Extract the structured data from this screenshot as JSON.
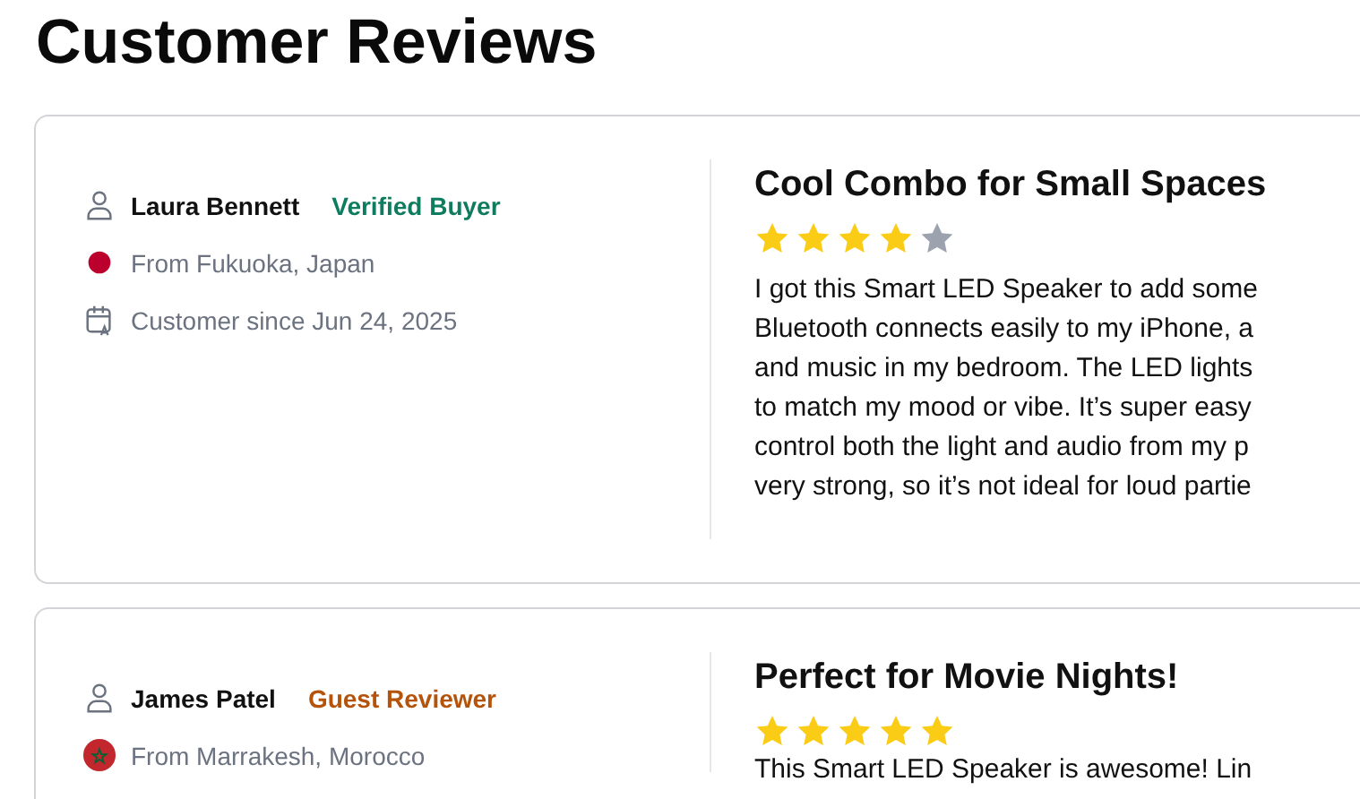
{
  "page_title": "Customer Reviews",
  "reviews": [
    {
      "reviewer": "Laura Bennett",
      "badge": {
        "text": "Verified Buyer",
        "kind": "verified"
      },
      "location": {
        "text": "From Fukuoka, Japan",
        "flag": {
          "kind": "dot",
          "color": "#bc002d"
        }
      },
      "customer_since": "Customer since Jun 24, 2025",
      "title": "Cool Combo for Small Spaces",
      "stars": 4,
      "body_lines": [
        "I got this Smart LED Speaker to add some",
        "Bluetooth connects easily to my iPhone, a",
        "and music in my bedroom. The LED lights",
        "to match my mood or vibe. It’s super easy",
        "control both the light and audio from my p",
        "very strong, so it’s not ideal for loud partie"
      ]
    },
    {
      "reviewer": "James Patel",
      "badge": {
        "text": "Guest Reviewer",
        "kind": "guest"
      },
      "location": {
        "text": "From Marrakesh, Morocco",
        "flag": {
          "kind": "star",
          "color": "#c1272d"
        }
      },
      "title": "Perfect for Movie Nights!",
      "stars": 5,
      "body_lines": [
        "This Smart LED Speaker is awesome! Lin"
      ]
    }
  ]
}
